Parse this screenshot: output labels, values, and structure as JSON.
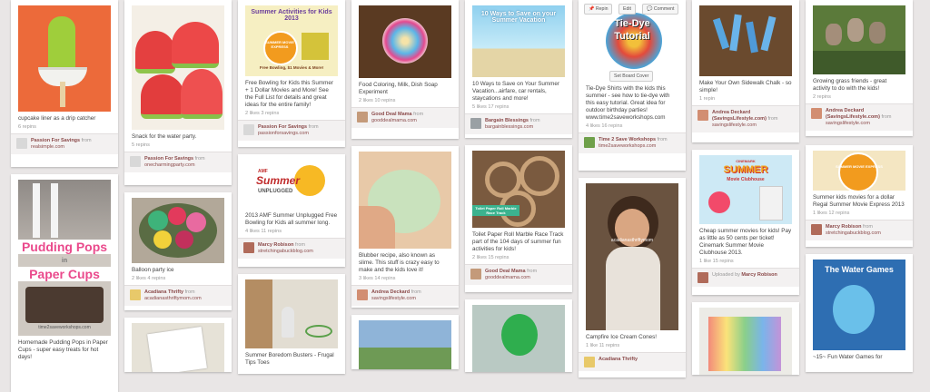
{
  "col1": {
    "pin1": {
      "desc": "cupcake liner as a drip catcher",
      "stats": "6 repins",
      "user": "Passion For Savings",
      "via": "from",
      "source": "realsimple.com"
    },
    "pin2": {
      "img_title_1": "Pudding Pops",
      "img_title_2": "in",
      "img_title_3": "Paper Cups",
      "img_watermark": "time2saveworkshops.com",
      "desc": "Homemade Pudding Pops in Paper Cups - super easy treats for hot days!"
    }
  },
  "col2": {
    "pin1": {
      "desc": "Snack for the water party.",
      "stats": "5 repins",
      "user": "Passion For Savings",
      "via": "from",
      "source": "onecharmingparty.com"
    },
    "pin2": {
      "desc": "Balloon party ice",
      "stats": "2 likes  4 repins",
      "user": "Acadiana Thrifty",
      "via": "from",
      "source": "acadianasthriftymom.com"
    }
  },
  "col3": {
    "pin1": {
      "img_title": "Summer Activities for Kids 2013",
      "img_badge": "SUMMER MOVIE EXPRESS",
      "img_caption": "Free Bowling, $1 Movies & More!",
      "desc": "Free Bowling for Kids this Summer + 1 Dollar Movies and More! See the Full List for details and great ideas for the entire family!",
      "stats": "2 likes  3 repins",
      "user": "Passion For Savings",
      "via": "from",
      "source": "passionforsavings.com"
    },
    "pin2": {
      "img_amf": "AMF",
      "img_title": "Summer",
      "img_title_2": "UNPLUGGED",
      "desc": "2013 AMF Summer Unplugged Free Bowling for Kids all summer long.",
      "stats": "4 likes  11 repins",
      "user": "Marcy Robison",
      "via": "from",
      "source": "stretchingabuckblog.com"
    },
    "pin3": {
      "desc": "Summer Boredom Busters - Frugal Tips Toes"
    }
  },
  "col4": {
    "pin1": {
      "desc": "Food Coloring, Milk, Dish Soap Experiment",
      "stats": "2 likes  10 repins",
      "user": "Good Deal Mama",
      "via": "from",
      "source": "gooddealmama.com"
    },
    "pin2": {
      "desc": "Blubber recipe, also known as slime. This stuff is crazy easy to make and the kids love it!",
      "stats": "3 likes  14 repins",
      "user": "Andrea Deckard",
      "via": "from",
      "source": "savingslifestyle.com"
    }
  },
  "col5": {
    "pin1": {
      "img_title": "10 Ways to Save on your Summer Vacation",
      "desc": "10 Ways to Save on Your Summer Vacation...airfare, car rentals, staycations and more!",
      "stats": "5 likes  17 repins",
      "user": "Bargain Blessings",
      "via": "from",
      "source": "bargainblessings.com"
    },
    "pin2": {
      "img_banner": "Toilet Paper Roll Marble Race Track",
      "desc": "Toilet Paper Roll Marble Race Track part of the 104 days of summer fun activities for kids!",
      "stats": "2 likes  15 repins",
      "user": "Good Deal Mama",
      "via": "from",
      "source": "gooddealmama.com"
    }
  },
  "col6": {
    "pin1": {
      "repin_label": "Repin",
      "edit_label": "Edit",
      "comment_label": "Comment",
      "img_title_1": "Tie-Dye",
      "img_title_2": "Tutorial",
      "board_cover_label": "Set Board Cover",
      "desc": "Tie-Dye Shirts with the kids this summer - see how to tie-dye with this easy tutorial. Great idea for outdoor birthday parties! www.time2saveworkshops.com",
      "stats": "4 likes  16 repins",
      "user": "Time 2 Save Workshops",
      "via": "from",
      "source": "time2saveworkshops.com"
    },
    "pin2": {
      "img_watermark": "acadianasthriftymom",
      "desc": "Campfire Ice Cream Cones!",
      "stats": "1 like  11 repins",
      "user": "Acadiana Thrifty"
    }
  },
  "col7": {
    "pin1": {
      "desc": "Make Your Own Sidewalk Chalk - so simple!",
      "stats": "1 repin",
      "user": "Andrea Deckard (SavingsLifestyle.com)",
      "via": "from",
      "source": "savingslifestyle.com"
    },
    "pin2": {
      "img_brand": "CINEMARK",
      "img_title": "SUMMER",
      "img_subtitle": "Movie Clubhouse",
      "desc": "Cheap summer movies for kids! Pay as little as 50 cents per ticket! Cinemark Summer Movie Clubhouse 2013.",
      "stats": "1 like  15 repins",
      "uploaded": "Uploaded by",
      "user": "Marcy Robison"
    }
  },
  "col8": {
    "pin1": {
      "desc": "Growing grass friends - great activity to do with the kids!",
      "stats": "2 repins",
      "user": "Andrea Deckard (SavingsLifestyle.com)",
      "via": "from",
      "source": "savingslifestyle.com"
    },
    "pin2": {
      "img_badge": "SUMMER MOVIE EXPRESS",
      "desc": "Summer kids movies for a dollar Regal Summer Movie Express 2013",
      "stats": "1 likes  12 repins",
      "user": "Marcy Robison",
      "via": "from",
      "source": "stretchingabuckblog.com"
    },
    "pin3": {
      "img_title": "The Water Games",
      "desc": "~15~ Fun Water Games for"
    }
  },
  "colors": {
    "background": "#e9e6e6",
    "card": "#ffffff",
    "attribution_bg": "#f3f1f1",
    "link": "#8b4a4a"
  }
}
